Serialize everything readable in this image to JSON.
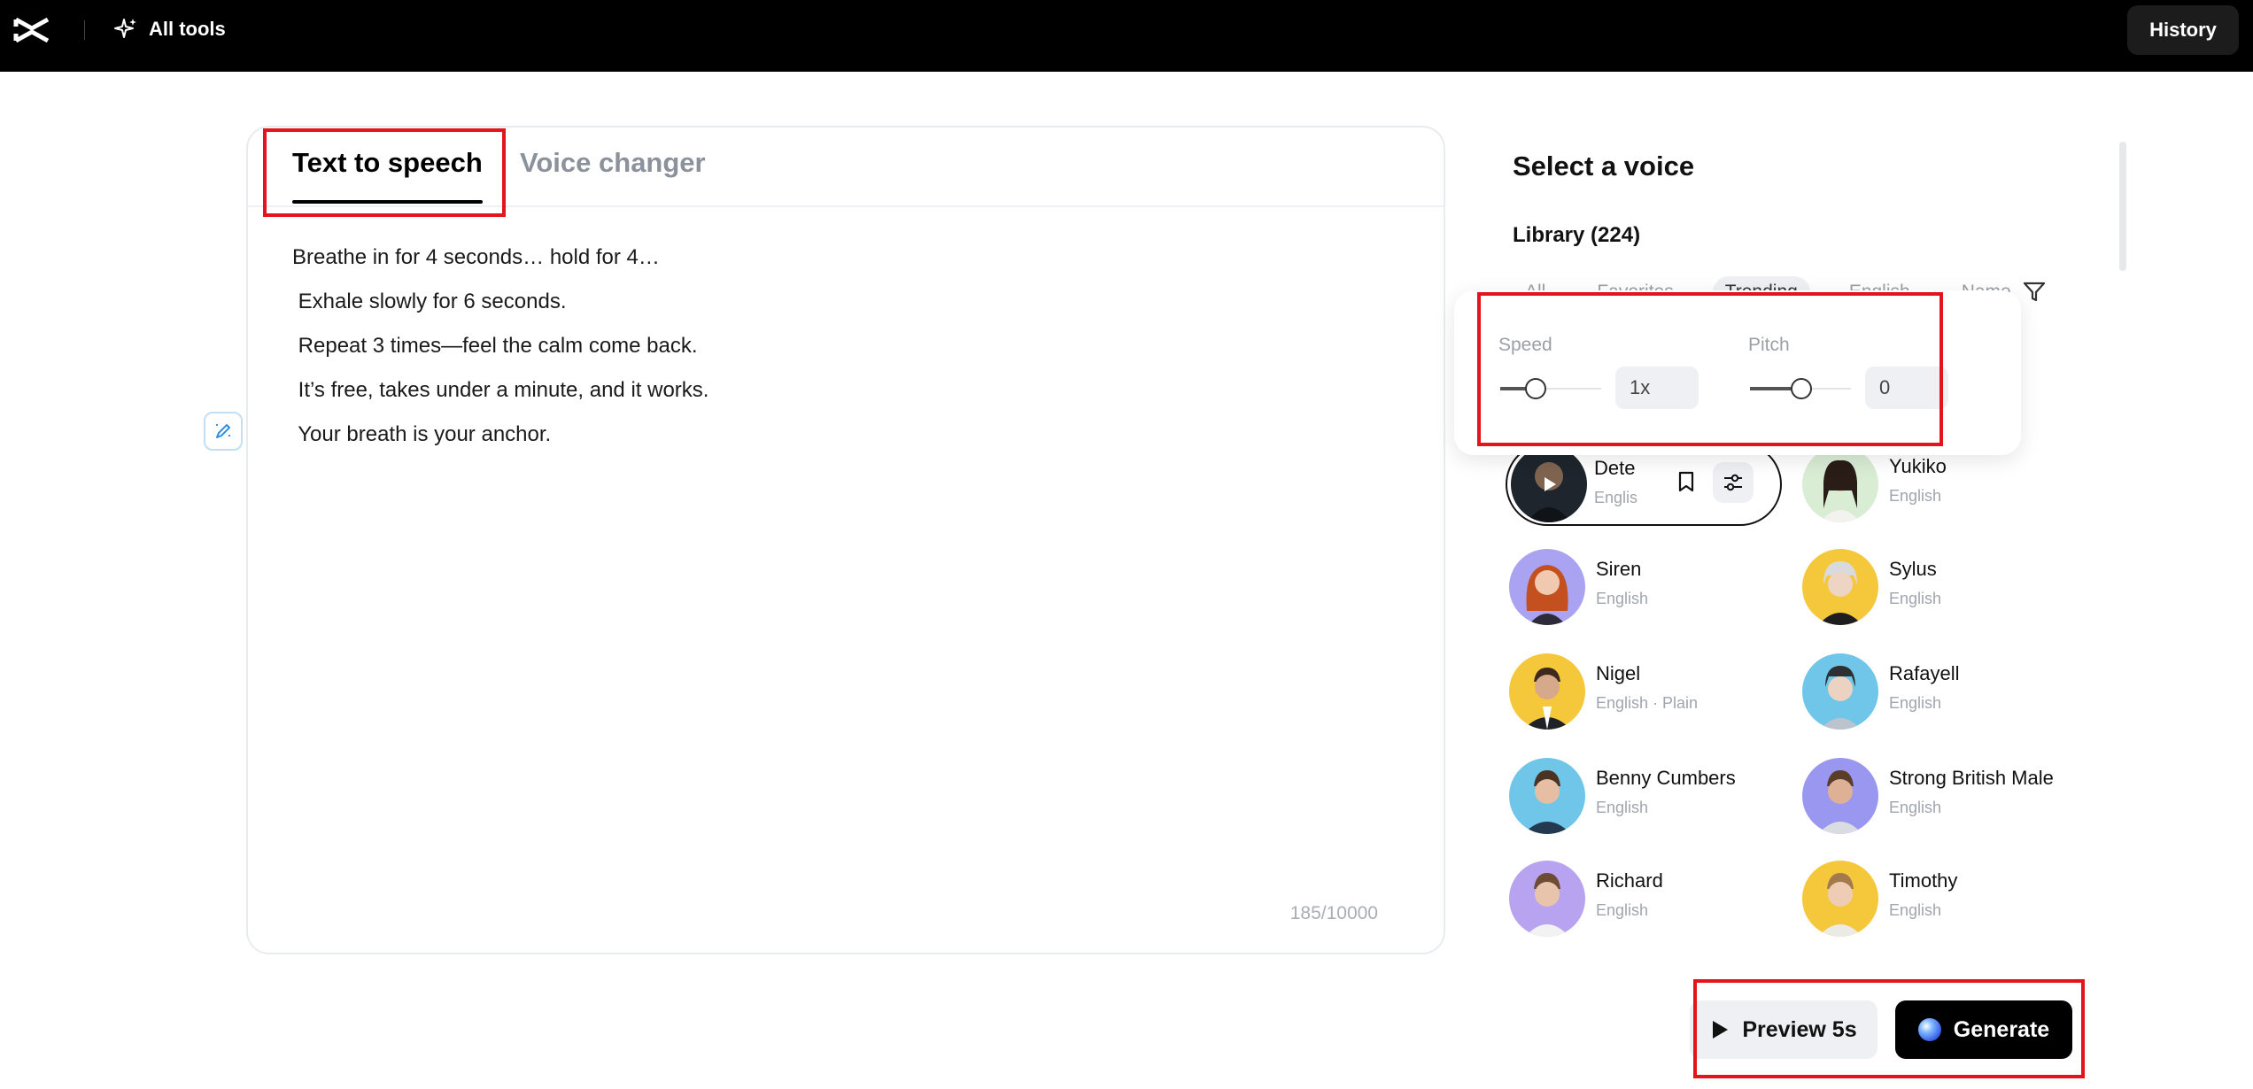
{
  "topbar": {
    "all_tools_label": "All tools",
    "history_label": "History"
  },
  "editor": {
    "tabs": [
      {
        "label": "Text to speech",
        "active": true
      },
      {
        "label": "Voice changer",
        "active": false
      }
    ],
    "lines": [
      "Breathe in for 4 seconds… hold for 4…",
      " Exhale slowly for 6 seconds.",
      " Repeat 3 times—feel the calm come back.",
      " It’s free, takes under a minute, and it works.",
      " Your breath is your anchor."
    ],
    "char_count": "185/10000"
  },
  "voice_panel": {
    "title": "Select a voice",
    "library_label": "Library (224)",
    "filters": [
      {
        "label": "All",
        "active": false
      },
      {
        "label": "Favorites",
        "active": false
      },
      {
        "label": "Trending",
        "active": true
      },
      {
        "label": "English",
        "active": false
      },
      {
        "label": "Name",
        "active": false
      }
    ],
    "voices": [
      {
        "name": "Dete",
        "lang": "Englis",
        "selected": true
      },
      {
        "name": "Yukiko",
        "lang": "English"
      },
      {
        "name": "Siren",
        "lang": "English"
      },
      {
        "name": "Sylus",
        "lang": "English"
      },
      {
        "name": "Nigel",
        "lang": "English · Plain"
      },
      {
        "name": "Rafayell",
        "lang": "English"
      },
      {
        "name": "Benny Cumbers",
        "lang": "English"
      },
      {
        "name": "Strong British Male",
        "lang": "English"
      },
      {
        "name": "Richard",
        "lang": "English"
      },
      {
        "name": "Timothy",
        "lang": "English"
      }
    ]
  },
  "settings_popup": {
    "speed_label": "Speed",
    "speed_value": "1x",
    "pitch_label": "Pitch",
    "pitch_value": "0"
  },
  "actions": {
    "preview_label": "Preview 5s",
    "generate_label": "Generate"
  },
  "colors": {
    "topbar_bg": "#000000",
    "annotation_red": "#e3141b",
    "primary_button": "#000000",
    "secondary_button": "#eef0f3"
  }
}
